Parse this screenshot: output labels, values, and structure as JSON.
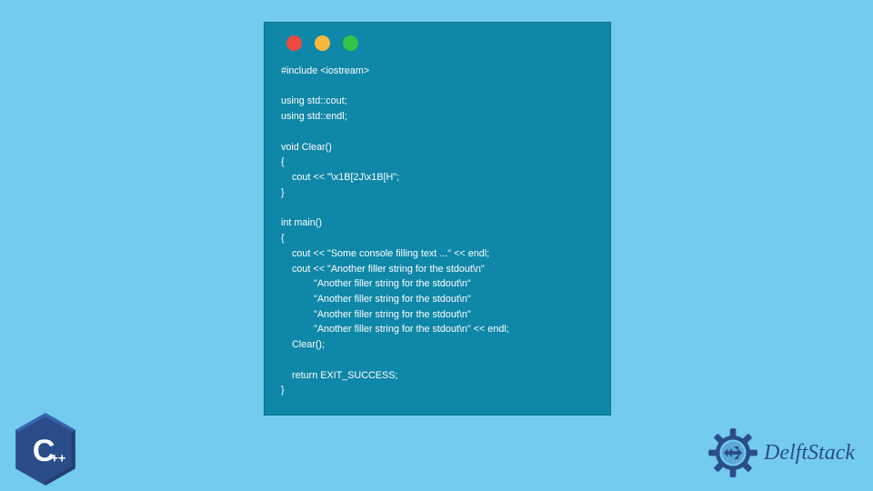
{
  "window": {
    "dots": [
      "red",
      "yellow",
      "green"
    ]
  },
  "code": {
    "text": "#include <iostream>\n\nusing std::cout;\nusing std::endl;\n\nvoid Clear()\n{\n    cout << \"\\x1B[2J\\x1B[H\";\n}\n\nint main()\n{\n    cout << \"Some console filling text ...\" << endl;\n    cout << \"Another filler string for the stdout\\n\"\n            \"Another filler string for the stdout\\n\"\n            \"Another filler string for the stdout\\n\"\n            \"Another filler string for the stdout\\n\"\n            \"Another filler string for the stdout\\n\" << endl;\n    Clear();\n\n    return EXIT_SUCCESS;\n}"
  },
  "branding": {
    "cpp_label": "C",
    "cpp_plus": "++",
    "site_name": "DelftStack"
  }
}
